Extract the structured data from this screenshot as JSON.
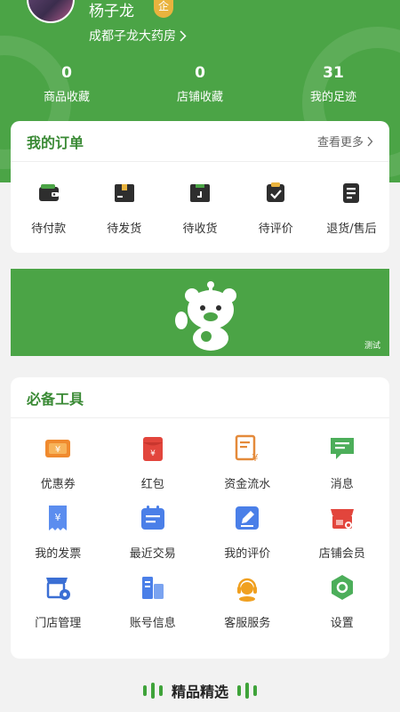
{
  "profile": {
    "username": "杨子龙",
    "badge": "企",
    "store_name": "成都子龙大药房"
  },
  "stats": [
    {
      "value": "0",
      "label": "商品收藏"
    },
    {
      "value": "0",
      "label": "店铺收藏"
    },
    {
      "value": "31",
      "label": "我的足迹"
    }
  ],
  "orders": {
    "title": "我的订单",
    "more_label": "查看更多",
    "items": [
      {
        "label": "待付款",
        "icon": "wallet-icon"
      },
      {
        "label": "待发货",
        "icon": "box-icon"
      },
      {
        "label": "待收货",
        "icon": "receive-box-icon"
      },
      {
        "label": "待评价",
        "icon": "review-check-icon"
      },
      {
        "label": "退货/售后",
        "icon": "return-list-icon"
      }
    ]
  },
  "banner": {
    "tag": "测试",
    "color": "#4ba446"
  },
  "tools": {
    "title": "必备工具",
    "items": [
      {
        "label": "优惠券",
        "icon": "coupon-icon"
      },
      {
        "label": "红包",
        "icon": "red-envelope-icon"
      },
      {
        "label": "资金流水",
        "icon": "fund-flow-icon"
      },
      {
        "label": "消息",
        "icon": "message-icon"
      },
      {
        "label": "我的发票",
        "icon": "invoice-icon"
      },
      {
        "label": "最近交易",
        "icon": "calendar-icon"
      },
      {
        "label": "我的评价",
        "icon": "edit-review-icon"
      },
      {
        "label": "店铺会员",
        "icon": "store-member-icon"
      },
      {
        "label": "门店管理",
        "icon": "store-settings-icon"
      },
      {
        "label": "账号信息",
        "icon": "account-building-icon"
      },
      {
        "label": "客服服务",
        "icon": "customer-service-icon"
      },
      {
        "label": "设置",
        "icon": "settings-icon"
      }
    ]
  },
  "footer": {
    "title": "精品精选"
  },
  "colors": {
    "brand_green": "#4ba446",
    "title_green": "#3a8a35"
  }
}
